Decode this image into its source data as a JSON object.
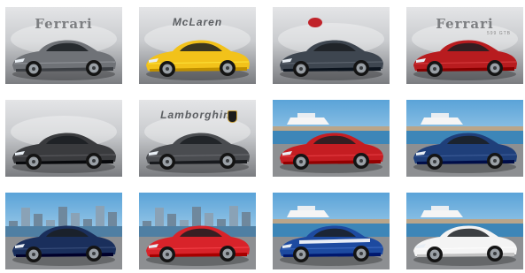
{
  "gallery": {
    "tiles": [
      {
        "brand_text": "Ferrari",
        "subtitle": "",
        "scene": "studio-grey",
        "car_color": "#6f7277",
        "car": "grey-gt"
      },
      {
        "brand_text": "McLaren",
        "subtitle": "",
        "scene": "studio-grey",
        "car_color": "#f2c21a",
        "car": "yellow-supercar"
      },
      {
        "brand_text": "",
        "subtitle": "",
        "scene": "studio-grey",
        "car_color": "#3e4650",
        "car": "blue-hypercar",
        "emblem": "red-oval"
      },
      {
        "brand_text": "Ferrari",
        "subtitle": "599 GTB",
        "scene": "studio-grey",
        "car_color": "#b81c1f",
        "car": "red-gt"
      },
      {
        "brand_text": "",
        "subtitle": "",
        "scene": "studio-grey",
        "car_color": "#3a3b3e",
        "car": "dark-supercar"
      },
      {
        "brand_text": "Lamborghini",
        "subtitle": "",
        "scene": "studio-grey",
        "car_color": "#4a4c50",
        "car": "dark-concept",
        "emblem": "gold-shield"
      },
      {
        "brand_text": "",
        "subtitle": "",
        "scene": "harbour",
        "car_color": "#c51d22",
        "car": "red-convertible"
      },
      {
        "brand_text": "",
        "subtitle": "",
        "scene": "harbour",
        "car_color": "#1f3f7a",
        "car": "blue-convertible"
      },
      {
        "brand_text": "",
        "subtitle": "",
        "scene": "city-sky",
        "car_color": "#1a2f5c",
        "car": "blue-sedan"
      },
      {
        "brand_text": "",
        "subtitle": "",
        "scene": "city-sky",
        "car_color": "#d8232a",
        "car": "red-roadster"
      },
      {
        "brand_text": "",
        "subtitle": "",
        "scene": "harbour",
        "car_color": "#1d4aa0",
        "car": "blue-stripe-gt"
      },
      {
        "brand_text": "",
        "subtitle": "",
        "scene": "harbour",
        "car_color": "#f4f4f4",
        "car": "white-convertible"
      }
    ]
  },
  "colors": {
    "studio_top": "#c9cbce",
    "studio_bottom": "#7a7c80",
    "sky_top": "#5aa3d8",
    "sky_bottom": "#d7ecf7",
    "sea": "#3d86b8",
    "road": "#8d8f92"
  }
}
